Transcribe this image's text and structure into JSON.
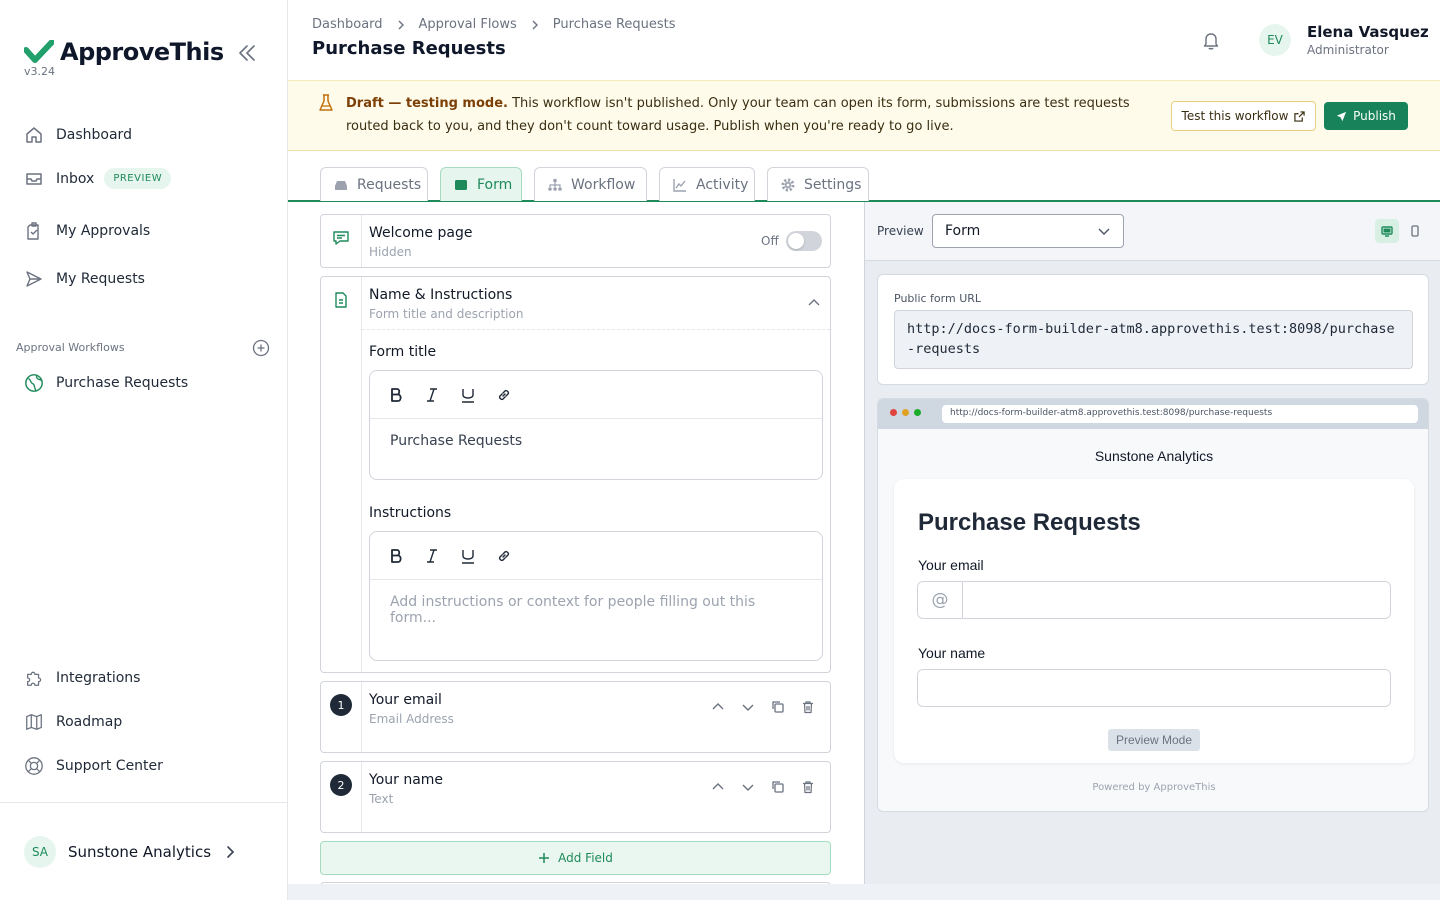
{
  "app": {
    "name": "ApproveThis",
    "version": "v3.24"
  },
  "sidebar": {
    "nav": [
      {
        "label": "Dashboard",
        "icon": "home-icon"
      },
      {
        "label": "Inbox",
        "badge": "PREVIEW",
        "icon": "inbox-icon"
      },
      {
        "label": "My Approvals",
        "icon": "clipboard-check-icon"
      },
      {
        "label": "My Requests",
        "icon": "send-icon"
      }
    ],
    "section_label": "Approval Workflows",
    "workflows": [
      {
        "label": "Purchase Requests",
        "icon": "globe-icon"
      }
    ],
    "bottom": [
      {
        "label": "Integrations",
        "icon": "puzzle-icon"
      },
      {
        "label": "Roadmap",
        "icon": "map-icon"
      },
      {
        "label": "Support Center",
        "icon": "lifebuoy-icon"
      }
    ],
    "org": {
      "initials": "SA",
      "name": "Sunstone Analytics"
    }
  },
  "header": {
    "breadcrumb": [
      "Dashboard",
      "Approval Flows",
      "Purchase Requests"
    ],
    "title": "Purchase Requests",
    "user": {
      "initials": "EV",
      "name": "Elena Vasquez",
      "role": "Administrator"
    }
  },
  "banner": {
    "strong": "Draft — testing mode.",
    "text": " This workflow isn't published. Only your team can open its form, submissions are test requests routed back to you, and they don't count toward usage. Publish when you're ready to go live.",
    "test_label": "Test this workflow",
    "publish_label": "Publish"
  },
  "tabs": [
    {
      "label": "Requests",
      "active": false
    },
    {
      "label": "Form",
      "active": true
    },
    {
      "label": "Workflow",
      "active": false
    },
    {
      "label": "Activity",
      "active": false
    },
    {
      "label": "Settings",
      "active": false
    }
  ],
  "builder": {
    "welcome": {
      "title": "Welcome page",
      "subtitle": "Hidden",
      "toggle_label": "Off",
      "enabled": false
    },
    "name_instructions": {
      "title": "Name & Instructions",
      "subtitle": "Form title and description",
      "form_title_label": "Form title",
      "form_title_value": "Purchase Requests",
      "instructions_label": "Instructions",
      "instructions_placeholder": "Add instructions or context for people filling out this form..."
    },
    "fields": [
      {
        "number": "1",
        "title": "Your email",
        "type": "Email Address"
      },
      {
        "number": "2",
        "title": "Your name",
        "type": "Text"
      }
    ],
    "add_field_label": "Add Field"
  },
  "preview": {
    "label": "Preview",
    "mode_selected": "Form",
    "url_label": "Public form URL",
    "url": "http://docs-form-builder-atm8.approvethis.test:8098/purchase-requests",
    "browser_url": "http://docs-form-builder-atm8.approvethis.test:8098/purchase-requests",
    "org_name": "Sunstone Analytics",
    "form_title": "Purchase Requests",
    "email_label": "Your email",
    "email_icon": "@",
    "name_label": "Your name",
    "preview_mode_label": "Preview Mode",
    "powered_by": "Powered by ApproveThis"
  },
  "colors": {
    "brand": "#1e8a5a",
    "publish": "#18835a",
    "banner_bg": "#fefbea",
    "dot_red": "#e0443e",
    "dot_yellow": "#dea123",
    "dot_green": "#1aab29"
  }
}
